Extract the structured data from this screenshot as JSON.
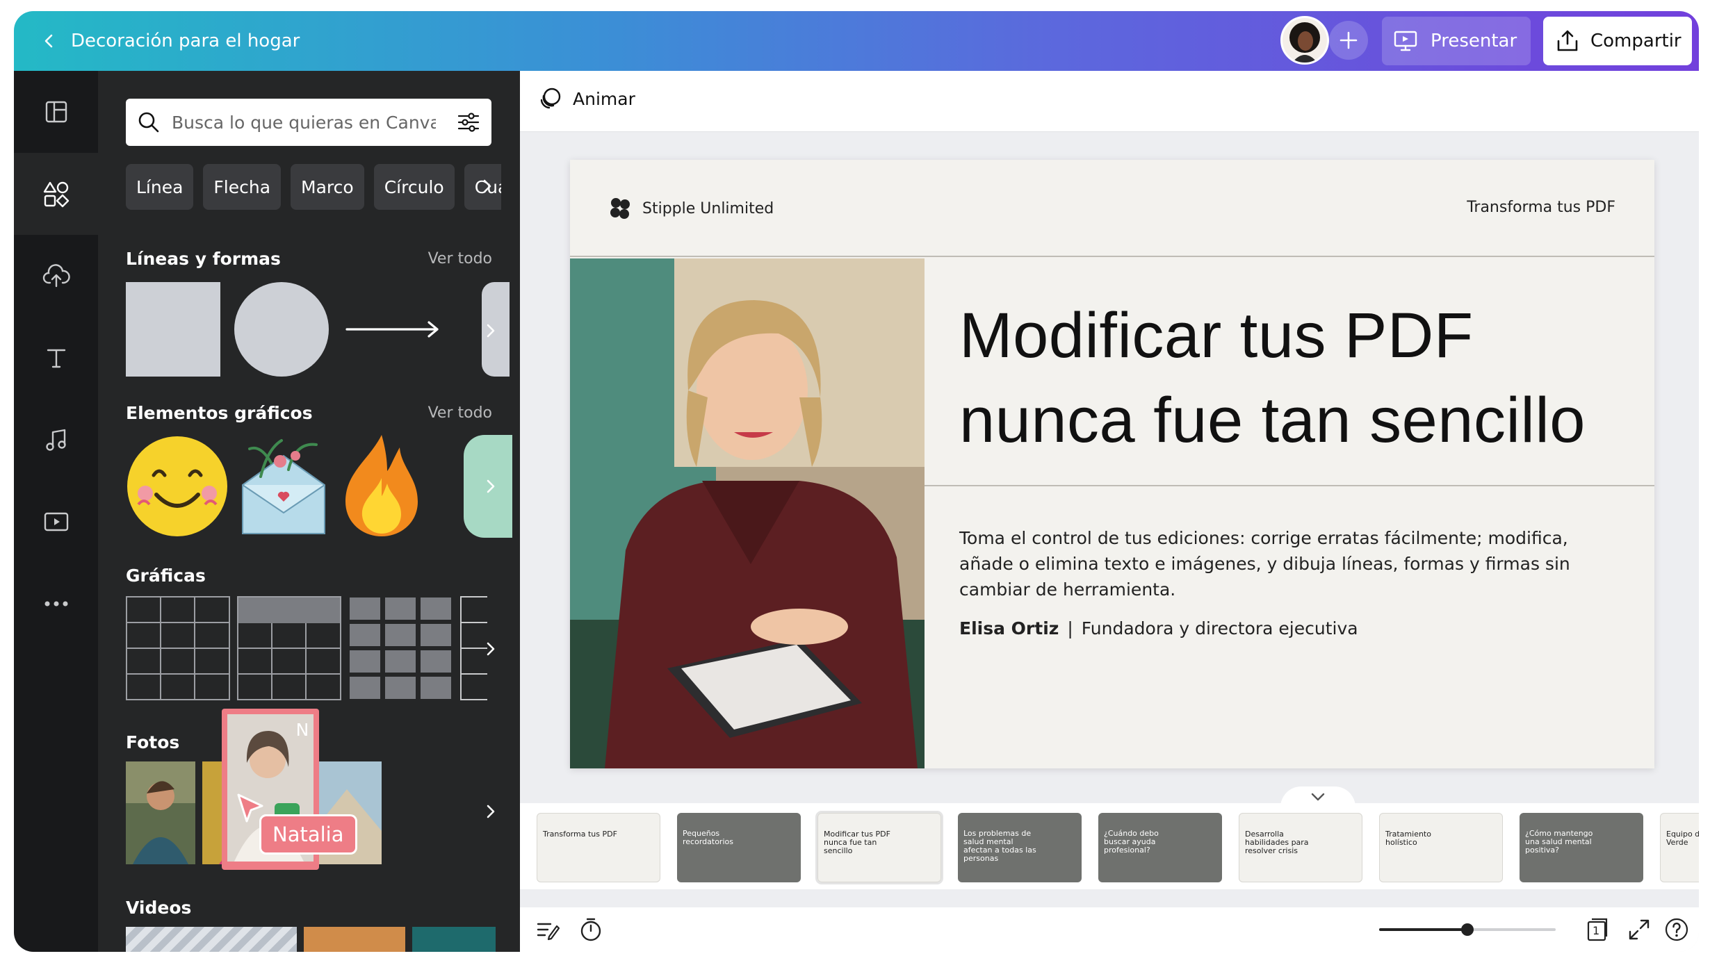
{
  "header": {
    "doc_title": "Decoración para el hogar",
    "present_label": "Presentar",
    "share_label": "Compartir"
  },
  "panel": {
    "search_placeholder": "Busca lo que quieras en Canva",
    "chips": [
      "Línea",
      "Flecha",
      "Marco",
      "Círculo",
      "Cua"
    ],
    "sections": {
      "lines_shapes": {
        "title": "Líneas y formas",
        "see_all": "Ver todo"
      },
      "graphics": {
        "title": "Elementos gráficos",
        "see_all": "Ver todo"
      },
      "charts": {
        "title": "Gráficas"
      },
      "photos": {
        "title": "Fotos"
      },
      "videos": {
        "title": "Videos"
      }
    },
    "collaborator": {
      "initial": "N",
      "name": "Natalia"
    }
  },
  "editor": {
    "animate_label": "Animar",
    "slide": {
      "brand": "Stipple Unlimited",
      "tagline": "Transforma tus PDF",
      "headline_line1": "Modificar tus PDF",
      "headline_line2": "nunca fue tan sencillo",
      "body": "Toma el control de tus ediciones: corrige erratas fácilmente; modifica, añade o elimina texto e imágenes, y dibuja líneas, formas y firmas sin cambiar de herramienta.",
      "author_name": "Elisa Ortiz",
      "separator": "|",
      "author_role": "Fundadora y directora ejecutiva"
    },
    "thumbnails": [
      {
        "title": "Transforma tus PDF",
        "style": "light"
      },
      {
        "title": "Pequeños recordatorios",
        "style": "dark"
      },
      {
        "title": "Modificar tus PDF nunca fue tan sencillo",
        "style": "light"
      },
      {
        "title": "Los problemas de salud mental afectan a todas las personas",
        "style": "dark"
      },
      {
        "title": "¿Cuándo debo buscar ayuda profesional?",
        "style": "dark"
      },
      {
        "title": "Desarrolla habilidades para resolver crisis",
        "style": "light"
      },
      {
        "title": "Tratamiento holístico",
        "style": "light"
      },
      {
        "title": "¿Cómo mantengo una salud mental positiva?",
        "style": "dark"
      },
      {
        "title": "Equipo de Vida Verde",
        "style": "light"
      }
    ],
    "selected_thumbnail": 3,
    "page_count": "1",
    "zoom_fraction": 0.5
  },
  "colors": {
    "topbar_start": "#24b9c6",
    "topbar_end": "#7240dc",
    "panel_bg": "#252627",
    "rail_bg": "#18191b",
    "collaborator": "#ee7d86"
  }
}
